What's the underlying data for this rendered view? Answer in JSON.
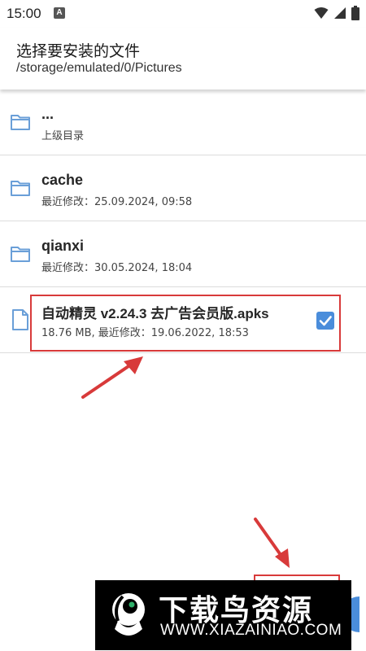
{
  "status_bar": {
    "time": "15:00",
    "app_badge": "A",
    "icons": [
      "wifi-icon",
      "signal-icon",
      "battery-icon"
    ]
  },
  "header": {
    "title": "选择要安装的文件",
    "path": "/storage/emulated/0/Pictures"
  },
  "list": [
    {
      "type": "folder",
      "name": "...",
      "subtitle": "上级目录"
    },
    {
      "type": "folder",
      "name": "cache",
      "subtitle": "最近修改：25.09.2024, 09:58"
    },
    {
      "type": "folder",
      "name": "qianxi",
      "subtitle": "最近修改：30.05.2024, 18:04"
    },
    {
      "type": "file",
      "name": "自动精灵 v2.24.3 去广告会员版.apks",
      "subtitle": "18.76 MB, 最近修改：19.06.2022, 18:53",
      "checked": true
    }
  ],
  "watermark": {
    "title": "下载鸟资源",
    "url": "WWW.XIAZAINIAO.COM"
  },
  "colors": {
    "accent": "#4a8ddb",
    "folder_icon": "#6a9fd8",
    "annotation_red": "#d83a3a"
  }
}
